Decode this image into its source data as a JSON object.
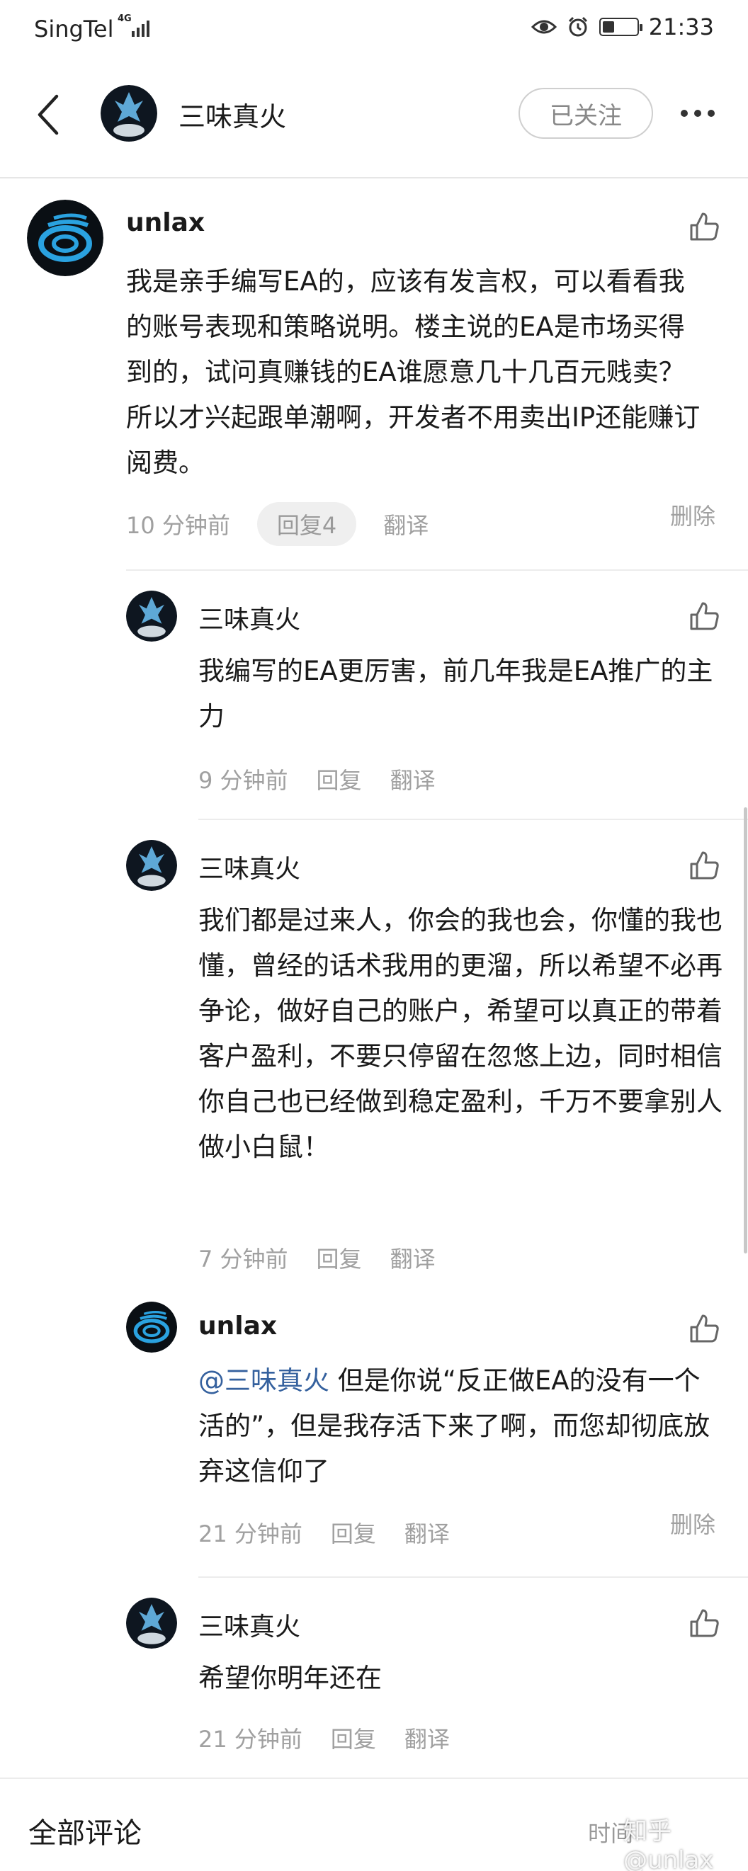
{
  "status_bar": {
    "carrier": "SingTel",
    "network_tag": "4G",
    "time": "21:33",
    "battery_level": 0.35
  },
  "nav": {
    "title": "三味真火",
    "follow_label": "已关注"
  },
  "comments": [
    {
      "author": "unlax",
      "body": "我是亲手编写EA的，应该有发言权，可以看看我的账号表现和策略说明。楼主说的EA是市场买得到的，试问真赚钱的EA谁愿意几十几百元贱卖？所以才兴起跟单潮啊，开发者不用卖出IP还能赚订阅费。",
      "time": "10 分钟前",
      "reply": "回复4",
      "translate": "翻译",
      "delete": "删除"
    },
    {
      "author": "三味真火",
      "body": "我编写的EA更厉害，前几年我是EA推广的主力",
      "time": "9 分钟前",
      "reply": "回复",
      "translate": "翻译"
    },
    {
      "author": "三味真火",
      "body": "我们都是过来人，你会的我也会，你懂的我也懂，曾经的话术我用的更溜，所以希望不必再争论，做好自己的账户，希望可以真正的带着客户盈利，不要只停留在忽悠上边，同时相信你自己也已经做到稳定盈利，千万不要拿别人做小白鼠！",
      "time": "7 分钟前",
      "reply": "回复",
      "translate": "翻译"
    },
    {
      "author": "unlax",
      "mention": "@三味真火",
      "body": " 但是你说“反正做EA的没有一个活的”，但是我存活下来了啊，而您却彻底放弃这信仰了",
      "time": "21 分钟前",
      "reply": "回复",
      "translate": "翻译",
      "delete": "删除"
    },
    {
      "author": "三味真火",
      "body": "希望你明年还在",
      "time": "21 分钟前",
      "reply": "回复",
      "translate": "翻译"
    }
  ],
  "footer": {
    "title": "全部评论",
    "sort": "时间",
    "watermark": "知乎 @unlax"
  },
  "icons": {
    "back": "chevron-left-icon",
    "more": "more-dots-icon",
    "like": "thumbs-up-icon",
    "eye": "eye-icon",
    "alarm": "alarm-icon",
    "battery": "battery-icon"
  },
  "colors": {
    "mention": "#35619e",
    "meta": "#a0a0a0",
    "text": "#1a1a1a"
  }
}
